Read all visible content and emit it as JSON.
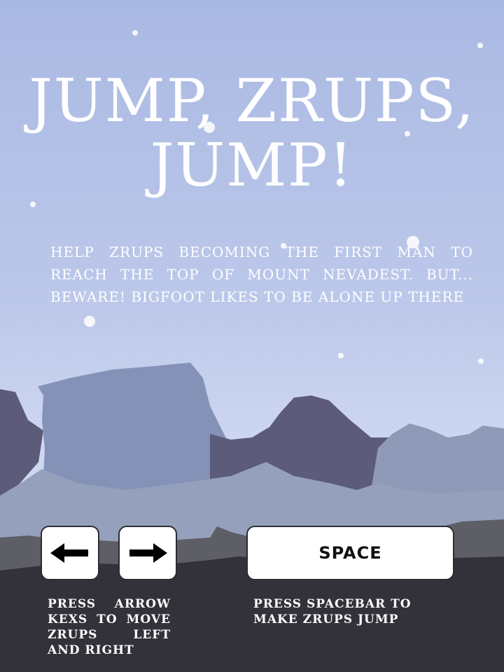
{
  "game": {
    "title_line_1": "JUMP, ZRUPS,",
    "title_line_2": "JUMP!",
    "intro": "HELP ZRUPS BECOMING THE FIRST MAN TO REACH THE TOP OF MOUNT NEVADEST. BUT... BEWARE! BIGFOOT LIKES TO BE ALONE UP THERE"
  },
  "controls": {
    "left_icon": "arrow-left-icon",
    "right_icon": "arrow-right-icon",
    "space_label": "SPACE",
    "arrows_help": "PRESS ARROW KEXS TO MOVE ZRUPS LEFT AND RIGHT",
    "space_help": "PRESS SPACEBAR TO MAKE ZRUPS JUMP"
  },
  "colors": {
    "sky_top": "#aab9e3",
    "sky_bottom": "#d5dcf2",
    "far_mountain": "#8592b8",
    "mid_mountain": "#5c5b7a",
    "near_hill": "#8f9ab8",
    "ridge": "#5e5e66",
    "ground": "#33323a",
    "text": "#ffffff"
  }
}
